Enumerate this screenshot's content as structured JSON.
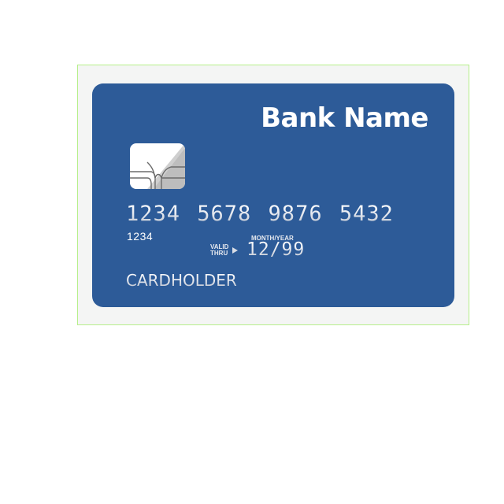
{
  "card": {
    "bank_name": "Bank Name",
    "number": "1234 5678 9876 5432",
    "number_small": "1234",
    "valid_line1": "VALID",
    "valid_line2": "THRU",
    "month_year_label": "MONTH/YEAR",
    "expiry": "12/99",
    "cardholder": "CARDHOLDER"
  },
  "colors": {
    "card_background": "#2d5b98",
    "frame_background": "#f4f5f4",
    "frame_border": "#b6ef8a",
    "chip_gold": "#d8d8d8",
    "text": "#ffffff"
  },
  "icons": {
    "chip": "emv-chip-icon",
    "arrow": "triangle-right-icon"
  }
}
